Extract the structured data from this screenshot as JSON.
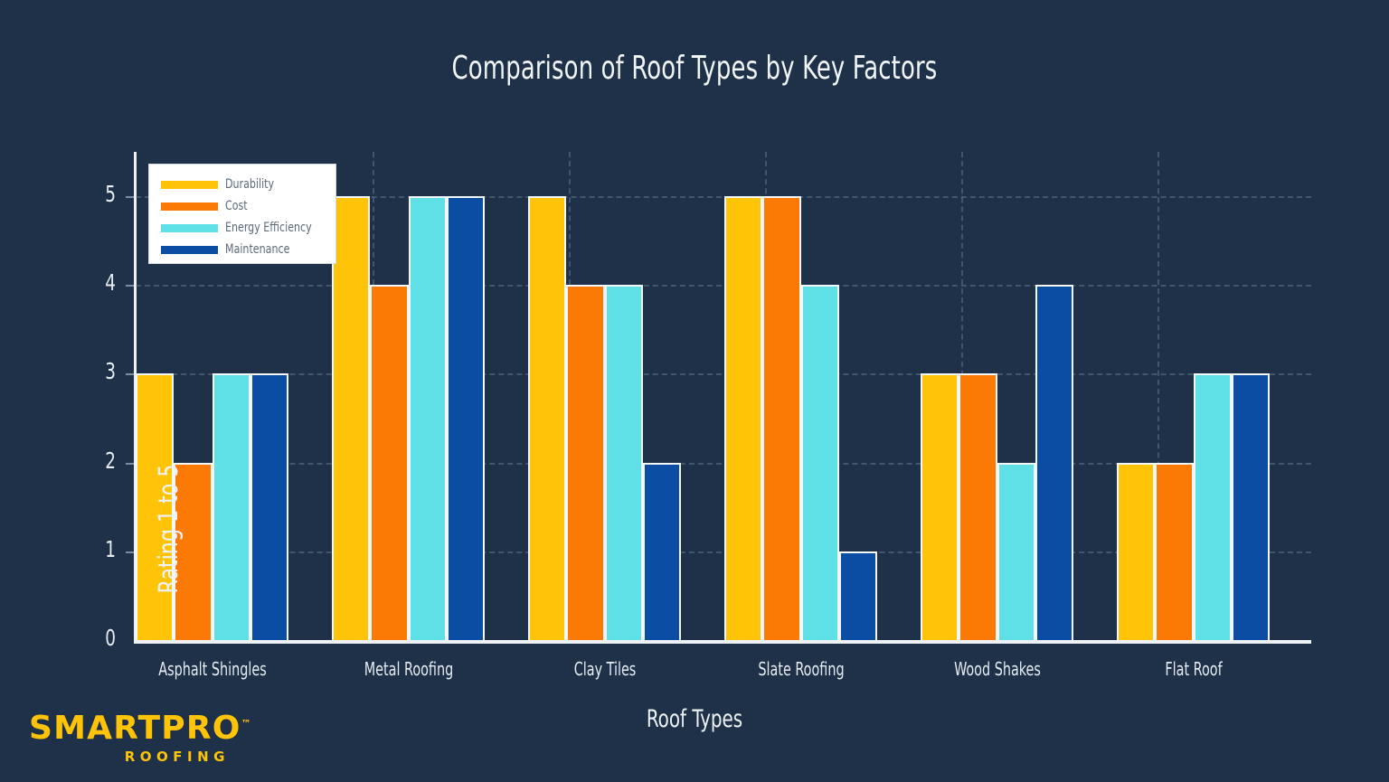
{
  "page": {
    "background_color": "#1e3148"
  },
  "branding": {
    "logo_main": "SMARTPRO",
    "logo_tm": "™",
    "logo_sub": "ROOFING",
    "logo_color": "#FFC408"
  },
  "chart_data": {
    "type": "bar",
    "title": "Comparison of Roof Types by Key Factors",
    "xlabel": "Roof Types",
    "ylabel": "Rating 1 to 5",
    "ylim": [
      0,
      5.5
    ],
    "yticks": [
      "0",
      "1",
      "2",
      "3",
      "4",
      "5"
    ],
    "ytick_values": [
      0,
      1,
      2,
      3,
      4,
      5
    ],
    "grid": true,
    "grid_style": "dashed",
    "legend_position": "upper left",
    "categories": [
      "Asphalt Shingles",
      "Metal Roofing",
      "Clay Tiles",
      "Slate Roofing",
      "Wood Shakes",
      "Flat Roof"
    ],
    "series": [
      {
        "name": "Durability",
        "color": "#FFC408",
        "values": [
          3,
          5,
          5,
          5,
          3,
          2
        ]
      },
      {
        "name": "Cost",
        "color": "#FB7A05",
        "values": [
          2,
          4,
          4,
          5,
          3,
          2
        ]
      },
      {
        "name": "Energy Efficiency",
        "color": "#5EE0E6",
        "values": [
          3,
          5,
          4,
          4,
          2,
          3
        ]
      },
      {
        "name": "Maintenance",
        "color": "#0B4DA2",
        "values": [
          3,
          5,
          2,
          1,
          4,
          3
        ]
      }
    ]
  }
}
